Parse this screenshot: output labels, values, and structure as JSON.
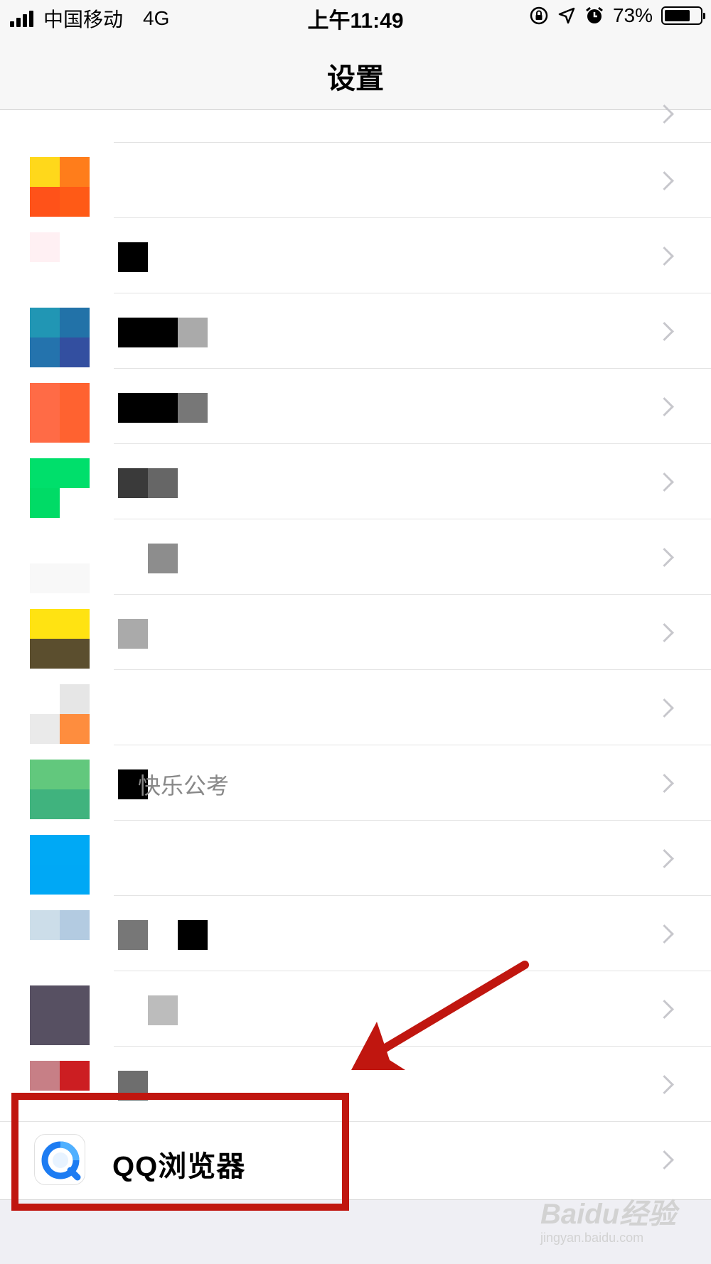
{
  "status_bar": {
    "carrier": "中国移动",
    "network": "4G",
    "time": "上午11:49",
    "battery": "73%",
    "battery_level": 0.73
  },
  "nav": {
    "title": "设置"
  },
  "rows": [
    {
      "colors": [
        "#ffd81b",
        "#ff7d1b",
        "#ff5219",
        "#ff5a16"
      ],
      "label_blocks": []
    },
    {
      "colors": [
        "#fff0f3",
        "#ffffff",
        "#ffffff",
        "#ffffff"
      ],
      "label_blocks": [
        "#000000"
      ]
    },
    {
      "colors": [
        "#2196b4",
        "#2272a8",
        "#2473ad",
        "#334fa0"
      ],
      "label_blocks": [
        "#000000",
        "#000000",
        "#aaaaaa"
      ]
    },
    {
      "colors": [
        "#ff6b46",
        "#ff6230",
        "#ff6b46",
        "#ff6230"
      ],
      "label_blocks": [
        "#000000",
        "#000000",
        "#777777"
      ]
    },
    {
      "colors": [
        "#00df6b",
        "#00df6b",
        "#00db66",
        "#ffffff"
      ],
      "label_blocks": [
        "#3a3a3a",
        "#666666"
      ]
    },
    {
      "colors": [
        "#ffffff",
        "#ffffff",
        "#f8f8f8",
        "#f8f8f8"
      ],
      "label_blocks": [
        "#ffffff",
        "#8d8d8d"
      ]
    },
    {
      "colors": [
        "#ffe312",
        "#ffe312",
        "#5b4e2e",
        "#5b4e2e"
      ],
      "label_blocks": [
        "#aaaaaa"
      ]
    },
    {
      "colors": [
        "#ffffff",
        "#e6e6e6",
        "#eaeaea",
        "#fe8d3e"
      ],
      "label_blocks": []
    },
    {
      "colors": [
        "#62c87d",
        "#62c87d",
        "#40b37e",
        "#40b37e"
      ],
      "label_blocks": [
        "#000000"
      ],
      "label_text": "快乐公考"
    },
    {
      "colors": [
        "#00a9f5",
        "#00a9f5",
        "#00a8f5",
        "#00a8f5"
      ],
      "label_blocks": []
    },
    {
      "colors": [
        "#ccdde9",
        "#b3cbe1",
        "#ffffff",
        "#ffffff"
      ],
      "label_blocks": [
        "#777777",
        "#ffffff",
        "#000000"
      ]
    },
    {
      "colors": [
        "#575062",
        "#575062",
        "#575062",
        "#575062"
      ],
      "label_blocks": [
        "#ffffff",
        "#bcbcbc"
      ]
    },
    {
      "colors": [
        "#c77f86",
        "#cc1e22",
        "#ffffff",
        "#ffffff"
      ],
      "label_blocks": [
        "#6e6e6e"
      ]
    }
  ],
  "qq_row": {
    "label": "QQ浏览器"
  },
  "watermark": {
    "main": "Baidu经验",
    "sub": "jingyan.baidu.com"
  },
  "colors": {
    "annotation": "#c0160f",
    "accent_blue": "#1d7cf2"
  }
}
